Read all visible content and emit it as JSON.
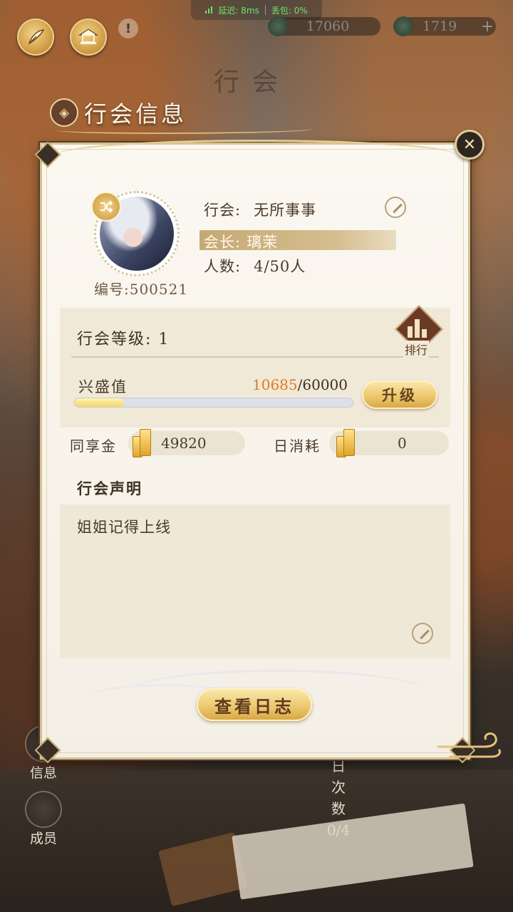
{
  "status_bar": {
    "latency": "延迟: 8ms",
    "packet_loss": "丢包: 0%"
  },
  "currencies": [
    {
      "value": "17060"
    },
    {
      "value": "1719"
    }
  ],
  "background_title": "行会",
  "side_nav": [
    {
      "label": "信息"
    },
    {
      "label": "成员"
    }
  ],
  "background_counter": {
    "text": "日次数",
    "value": "0/4"
  },
  "panel": {
    "title": "行会信息",
    "guild_name_label": "行会:",
    "guild_name": "无所事事",
    "leader_label": "会长:",
    "leader_name": "璃茉",
    "members_label": "人数:",
    "members_value": "4/50人",
    "member_id": "编号:500521",
    "level_label": "行会等级:",
    "level_value": "1",
    "rank_label": "排行",
    "prosperity_label": "兴盛值",
    "prosperity_current": "10685",
    "prosperity_max": "/60000",
    "prosperity_fraction": 0.178,
    "upgrade_button": "升级",
    "shared_gold_label": "同享金",
    "shared_gold_value": "49820",
    "daily_cost_label": "日消耗",
    "daily_cost_value": "0",
    "declaration_title": "行会声明",
    "declaration_text": "姐姐记得上线",
    "view_log_button": "查看日志"
  },
  "colors": {
    "accent_gold": "#e2c27a",
    "prosperity_number": "#e27a1e",
    "panel_bg": "#f8f4eb"
  }
}
